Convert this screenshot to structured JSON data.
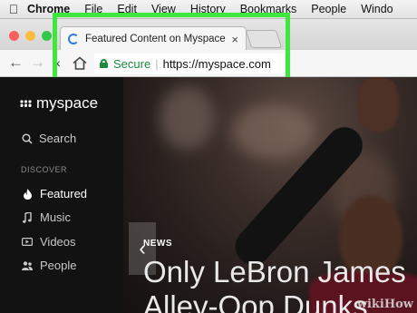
{
  "menubar": {
    "items": [
      "Chrome",
      "File",
      "Edit",
      "View",
      "History",
      "Bookmarks",
      "People",
      "Windo"
    ]
  },
  "browser": {
    "tab_title": "Featured Content on Myspace",
    "tab_close": "×",
    "secure_label": "Secure",
    "url": "https://myspace.com",
    "traffic_colors": [
      "#fc605c",
      "#fdbc40",
      "#34c84a"
    ],
    "highlight_color": "#3ee63e"
  },
  "sidebar": {
    "logo_text": "myspace",
    "search_label": "Search",
    "section_label": "DISCOVER",
    "items": [
      {
        "label": "Featured",
        "icon": "flame-icon",
        "active": true
      },
      {
        "label": "Music",
        "icon": "music-note-icon",
        "active": false
      },
      {
        "label": "Videos",
        "icon": "video-icon",
        "active": false
      },
      {
        "label": "People",
        "icon": "people-icon",
        "active": false
      }
    ]
  },
  "hero": {
    "category": "NEWS",
    "headline_line1": "Only LeBron James",
    "headline_line2": "Alley-Oop Dunks"
  },
  "watermark": "wikiHow"
}
